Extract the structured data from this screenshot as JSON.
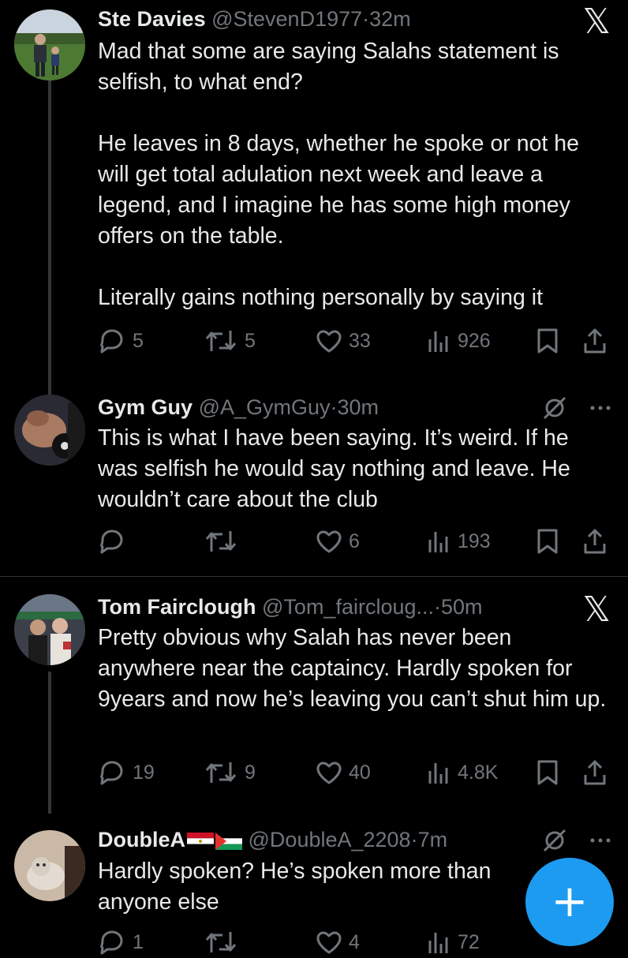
{
  "tweets": [
    {
      "name": "Ste Davies",
      "handle": "@StevenD1977",
      "time": "32m",
      "text": "Mad that some are saying Salahs statement is selfish, to what end?\n\nHe leaves in 8 days, whether he spoke or not he will get total adulation next week and leave a legend, and I imagine he has some high money offers on the table.\n\nLiterally gains nothing personally by saying it",
      "replies": "5",
      "reposts": "5",
      "likes": "33",
      "views": "926",
      "top_icon": "x-logo"
    },
    {
      "name": "Gym Guy",
      "handle": "@A_GymGuy",
      "time": "30m",
      "text": "This is what I have been saying. It’s weird. If he was selfish he would say nothing and leave. He wouldn’t care about the club",
      "replies": "",
      "reposts": "",
      "likes": "6",
      "views": "193",
      "top_icon": "grok-icon"
    },
    {
      "name": "Tom Fairclough",
      "handle": "@Tom_faircloug...",
      "time": "50m",
      "text": "Pretty obvious why Salah has never been anywhere near the captaincy. Hardly spoken for 9years and now he’s leaving you can’t shut him up.",
      "replies": "19",
      "reposts": "9",
      "likes": "40",
      "views": "4.8K",
      "top_icon": "x-logo"
    },
    {
      "name": "DoubleA",
      "handle": "@DoubleA_2208",
      "time": "7m",
      "text": "Hardly spoken? He’s spoken more than anyone else",
      "replies": "1",
      "reposts": "",
      "likes": "4",
      "views": "72",
      "top_icon": "grok-icon"
    }
  ],
  "separator": "·",
  "x_logo_glyph": "𝕏",
  "fab_label": "+",
  "colors": {
    "background": "#000000",
    "text": "#e7e9ea",
    "muted": "#71767b",
    "accent": "#1d9bf0"
  }
}
